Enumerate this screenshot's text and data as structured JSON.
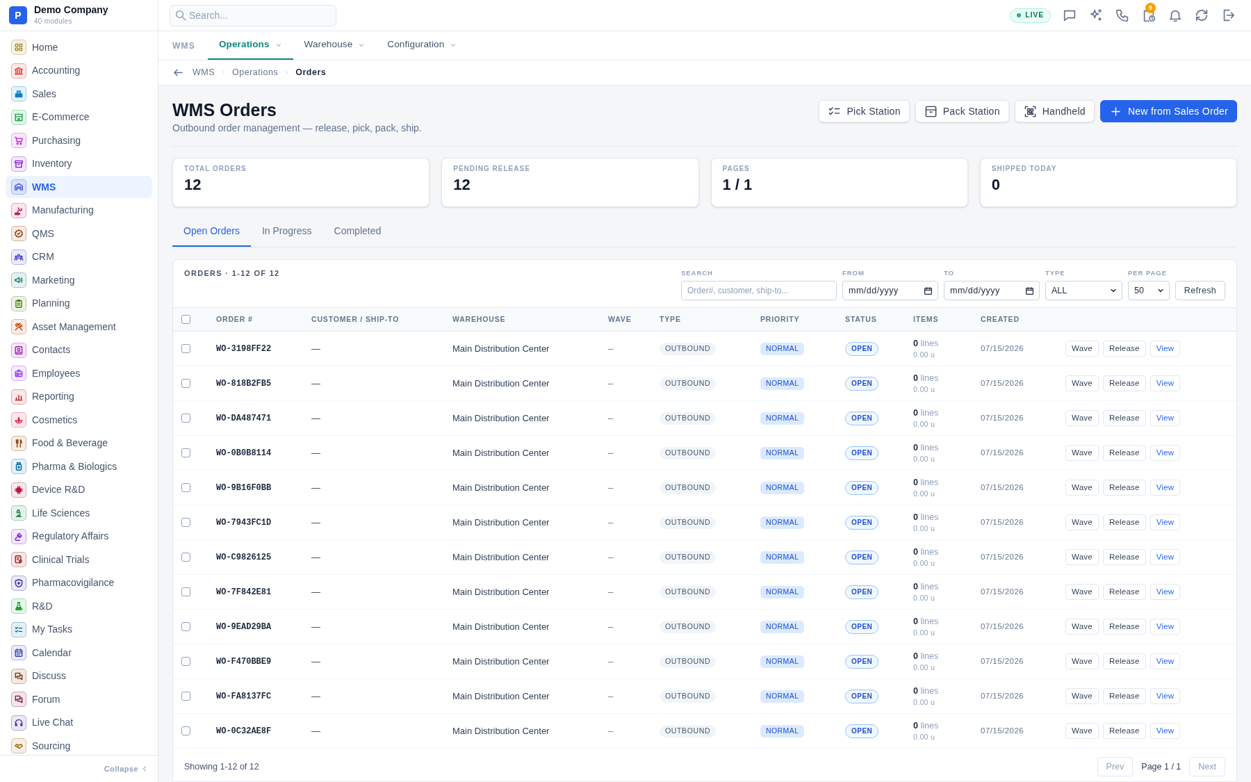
{
  "sidebar": {
    "logo_letter": "P",
    "company": "Demo Company",
    "subtitle": "40 modules",
    "items": [
      {
        "label": "Home",
        "color": "#a08424",
        "selected": false
      },
      {
        "label": "Accounting",
        "color": "#dc2626",
        "selected": false
      },
      {
        "label": "Sales",
        "color": "#0284c7",
        "selected": false
      },
      {
        "label": "E-Commerce",
        "color": "#16a34a",
        "selected": false
      },
      {
        "label": "Purchasing",
        "color": "#c026d3",
        "selected": false
      },
      {
        "label": "Inventory",
        "color": "#7e22ce",
        "selected": false
      },
      {
        "label": "WMS",
        "color": "#3b4fd8",
        "selected": true
      },
      {
        "label": "Manufacturing",
        "color": "#be185d",
        "selected": false
      },
      {
        "label": "QMS",
        "color": "#92400e",
        "selected": false
      },
      {
        "label": "CRM",
        "color": "#4338ca",
        "selected": false
      },
      {
        "label": "Marketing",
        "color": "#0f766e",
        "selected": false
      },
      {
        "label": "Planning",
        "color": "#4d7c0f",
        "selected": false
      },
      {
        "label": "Asset Management",
        "color": "#c2410c",
        "selected": false
      },
      {
        "label": "Contacts",
        "color": "#a21caf",
        "selected": false
      },
      {
        "label": "Employees",
        "color": "#9333ea",
        "selected": false
      },
      {
        "label": "Reporting",
        "color": "#b91c1c",
        "selected": false
      },
      {
        "label": "Cosmetics",
        "color": "#e11d48",
        "selected": false
      },
      {
        "label": "Food & Beverage",
        "color": "#9a4a12",
        "selected": false
      },
      {
        "label": "Pharma & Biologics",
        "color": "#0369a1",
        "selected": false
      },
      {
        "label": "Device R&D",
        "color": "#be123c",
        "selected": false
      },
      {
        "label": "Life Sciences",
        "color": "#15803d",
        "selected": false
      },
      {
        "label": "Regulatory Affairs",
        "color": "#7e22ce",
        "selected": false
      },
      {
        "label": "Clinical Trials",
        "color": "#991b1b",
        "selected": false
      },
      {
        "label": "Pharmacovigilance",
        "color": "#3730a3",
        "selected": false
      },
      {
        "label": "R&D",
        "color": "#22a33a",
        "selected": false
      },
      {
        "label": "My Tasks",
        "color": "#0369a1",
        "selected": false
      },
      {
        "label": "Calendar",
        "color": "#3740b0",
        "selected": false
      },
      {
        "label": "Discuss",
        "color": "#78350f",
        "selected": false
      },
      {
        "label": "Forum",
        "color": "#831843",
        "selected": false
      },
      {
        "label": "Live Chat",
        "color": "#3730a3",
        "selected": false
      },
      {
        "label": "Sourcing",
        "color": "#a16207",
        "selected": false
      }
    ],
    "collapse_label": "Collapse"
  },
  "topbar": {
    "search_placeholder": "Search...",
    "live_label": "LIVE",
    "notification_count": "9"
  },
  "nav": {
    "module": "WMS",
    "tabs": [
      {
        "label": "Operations",
        "selected": true
      },
      {
        "label": "Warehouse",
        "selected": false
      },
      {
        "label": "Configuration",
        "selected": false
      }
    ]
  },
  "breadcrumb": [
    "WMS",
    "Operations",
    "Orders"
  ],
  "header": {
    "title": "WMS Orders",
    "subtitle": "Outbound order management — release, pick, pack, ship.",
    "actions": [
      {
        "label": "Pick Station",
        "kind": "secondary"
      },
      {
        "label": "Pack Station",
        "kind": "secondary"
      },
      {
        "label": "Handheld",
        "kind": "secondary"
      },
      {
        "label": "New from Sales Order",
        "kind": "primary"
      }
    ]
  },
  "stats": [
    {
      "label": "TOTAL ORDERS",
      "value": "12"
    },
    {
      "label": "PENDING RELEASE",
      "value": "12"
    },
    {
      "label": "PAGES",
      "value": "1 / 1"
    },
    {
      "label": "SHIPPED TODAY",
      "value": "0"
    }
  ],
  "tabs": [
    {
      "label": "Open Orders",
      "selected": true
    },
    {
      "label": "In Progress",
      "selected": false
    },
    {
      "label": "Completed",
      "selected": false
    }
  ],
  "orders": {
    "title": "ORDERS · 1-12 OF 12",
    "filters": [
      {
        "label": "SEARCH",
        "kind": "text",
        "placeholder": "Order#, customer, ship-to..."
      },
      {
        "label": "FROM",
        "kind": "date",
        "placeholder": "mm/dd/yyyy"
      },
      {
        "label": "TO",
        "kind": "date",
        "placeholder": "mm/dd/yyyy"
      },
      {
        "label": "TYPE",
        "kind": "select",
        "value": "ALL"
      },
      {
        "label": "PER PAGE",
        "kind": "select",
        "value": "50"
      }
    ],
    "refresh_label": "Refresh",
    "select_all_checked": false,
    "columns": [
      "ORDER #",
      "CUSTOMER / SHIP-TO",
      "WAREHOUSE",
      "WAVE",
      "TYPE",
      "PRIORITY",
      "STATUS",
      "ITEMS",
      "CREATED"
    ],
    "rows": [
      {
        "checked": false,
        "order": "WO-3198FF22",
        "customer": "—",
        "warehouse": "Main Distribution Center",
        "wave": "–",
        "type": "OUTBOUND",
        "priority": "NORMAL",
        "status": "OPEN",
        "items": "**0** lines",
        "units": "0.00 u",
        "created": "07/15/2026",
        "actions": [
          {
            "label": "Wave",
            "kind": "button"
          },
          {
            "label": "Release",
            "kind": "button"
          },
          {
            "label": "View",
            "kind": "link"
          }
        ]
      },
      {
        "checked": false,
        "order": "WO-818B2FB5",
        "customer": "—",
        "warehouse": "Main Distribution Center",
        "wave": "–",
        "type": "OUTBOUND",
        "priority": "NORMAL",
        "status": "OPEN",
        "items": "**0** lines",
        "units": "0.00 u",
        "created": "07/15/2026",
        "actions": [
          {
            "label": "Wave",
            "kind": "button"
          },
          {
            "label": "Release",
            "kind": "button"
          },
          {
            "label": "View",
            "kind": "link"
          }
        ]
      },
      {
        "checked": false,
        "order": "WO-DA487471",
        "customer": "—",
        "warehouse": "Main Distribution Center",
        "wave": "–",
        "type": "OUTBOUND",
        "priority": "NORMAL",
        "status": "OPEN",
        "items": "**0** lines",
        "units": "0.00 u",
        "created": "07/15/2026",
        "actions": [
          {
            "label": "Wave",
            "kind": "button"
          },
          {
            "label": "Release",
            "kind": "button"
          },
          {
            "label": "View",
            "kind": "link"
          }
        ]
      },
      {
        "checked": false,
        "order": "WO-0B0B8114",
        "customer": "—",
        "warehouse": "Main Distribution Center",
        "wave": "–",
        "type": "OUTBOUND",
        "priority": "NORMAL",
        "status": "OPEN",
        "items": "**0** lines",
        "units": "0.00 u",
        "created": "07/15/2026",
        "actions": [
          {
            "label": "Wave",
            "kind": "button"
          },
          {
            "label": "Release",
            "kind": "button"
          },
          {
            "label": "View",
            "kind": "link"
          }
        ]
      },
      {
        "checked": false,
        "order": "WO-9B16F0BB",
        "customer": "—",
        "warehouse": "Main Distribution Center",
        "wave": "–",
        "type": "OUTBOUND",
        "priority": "NORMAL",
        "status": "OPEN",
        "items": "**0** lines",
        "units": "0.00 u",
        "created": "07/15/2026",
        "actions": [
          {
            "label": "Wave",
            "kind": "button"
          },
          {
            "label": "Release",
            "kind": "button"
          },
          {
            "label": "View",
            "kind": "link"
          }
        ]
      },
      {
        "checked": false,
        "order": "WO-7943FC1D",
        "customer": "—",
        "warehouse": "Main Distribution Center",
        "wave": "–",
        "type": "OUTBOUND",
        "priority": "NORMAL",
        "status": "OPEN",
        "items": "**0** lines",
        "units": "0.00 u",
        "created": "07/15/2026",
        "actions": [
          {
            "label": "Wave",
            "kind": "button"
          },
          {
            "label": "Release",
            "kind": "button"
          },
          {
            "label": "View",
            "kind": "link"
          }
        ]
      },
      {
        "checked": false,
        "order": "WO-C9826125",
        "customer": "—",
        "warehouse": "Main Distribution Center",
        "wave": "–",
        "type": "OUTBOUND",
        "priority": "NORMAL",
        "status": "OPEN",
        "items": "**0** lines",
        "units": "0.00 u",
        "created": "07/15/2026",
        "actions": [
          {
            "label": "Wave",
            "kind": "button"
          },
          {
            "label": "Release",
            "kind": "button"
          },
          {
            "label": "View",
            "kind": "link"
          }
        ]
      },
      {
        "checked": false,
        "order": "WO-7F842E81",
        "customer": "—",
        "warehouse": "Main Distribution Center",
        "wave": "–",
        "type": "OUTBOUND",
        "priority": "NORMAL",
        "status": "OPEN",
        "items": "**0** lines",
        "units": "0.00 u",
        "created": "07/15/2026",
        "actions": [
          {
            "label": "Wave",
            "kind": "button"
          },
          {
            "label": "Release",
            "kind": "button"
          },
          {
            "label": "View",
            "kind": "link"
          }
        ]
      },
      {
        "checked": false,
        "order": "WO-9EAD29BA",
        "customer": "—",
        "warehouse": "Main Distribution Center",
        "wave": "–",
        "type": "OUTBOUND",
        "priority": "NORMAL",
        "status": "OPEN",
        "items": "**0** lines",
        "units": "0.00 u",
        "created": "07/15/2026",
        "actions": [
          {
            "label": "Wave",
            "kind": "button"
          },
          {
            "label": "Release",
            "kind": "button"
          },
          {
            "label": "View",
            "kind": "link"
          }
        ]
      },
      {
        "checked": false,
        "order": "WO-F470BBE9",
        "customer": "—",
        "warehouse": "Main Distribution Center",
        "wave": "–",
        "type": "OUTBOUND",
        "priority": "NORMAL",
        "status": "OPEN",
        "items": "**0** lines",
        "units": "0.00 u",
        "created": "07/15/2026",
        "actions": [
          {
            "label": "Wave",
            "kind": "button"
          },
          {
            "label": "Release",
            "kind": "button"
          },
          {
            "label": "View",
            "kind": "link"
          }
        ]
      },
      {
        "checked": false,
        "order": "WO-FA8137FC",
        "customer": "—",
        "warehouse": "Main Distribution Center",
        "wave": "–",
        "type": "OUTBOUND",
        "priority": "NORMAL",
        "status": "OPEN",
        "items": "**0** lines",
        "units": "0.00 u",
        "created": "07/15/2026",
        "actions": [
          {
            "label": "Wave",
            "kind": "button"
          },
          {
            "label": "Release",
            "kind": "button"
          },
          {
            "label": "View",
            "kind": "link"
          }
        ]
      },
      {
        "checked": false,
        "order": "WO-0C32AE8F",
        "customer": "—",
        "warehouse": "Main Distribution Center",
        "wave": "–",
        "type": "OUTBOUND",
        "priority": "NORMAL",
        "status": "OPEN",
        "items": "**0** lines",
        "units": "0.00 u",
        "created": "07/15/2026",
        "actions": [
          {
            "label": "Wave",
            "kind": "button"
          },
          {
            "label": "Release",
            "kind": "button"
          },
          {
            "label": "View",
            "kind": "link"
          }
        ]
      }
    ],
    "footer": {
      "summary": "Showing 1-12 of 12",
      "prev": {
        "label": "Prev",
        "disabled": true
      },
      "page": "Page 1 / 1",
      "next": {
        "label": "Next",
        "disabled": true
      }
    }
  }
}
